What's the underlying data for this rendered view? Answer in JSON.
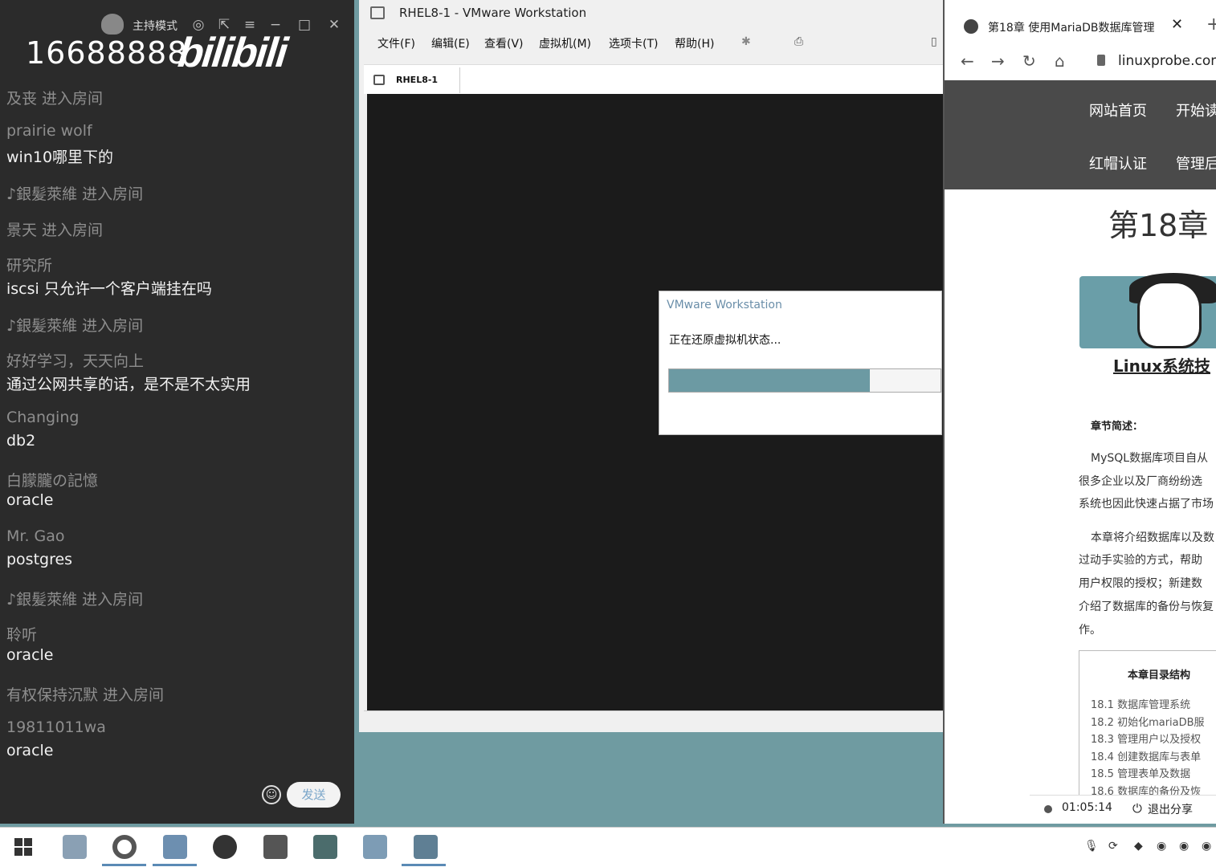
{
  "chat": {
    "room_id": "16688888",
    "logo": "bilibili",
    "host_mode_label": "主持模式",
    "messages": [
      {
        "kind": "enter",
        "text": "及丧 进入房间"
      },
      {
        "kind": "user",
        "text": "prairie wolf"
      },
      {
        "kind": "text",
        "text": "win10哪里下的"
      },
      {
        "kind": "enter",
        "text": "♪銀髪萊維 进入房间"
      },
      {
        "kind": "enter",
        "text": "景天 进入房间"
      },
      {
        "kind": "user",
        "text": "研究所"
      },
      {
        "kind": "text",
        "text": "iscsi 只允许一个客户端挂在吗"
      },
      {
        "kind": "enter",
        "text": "♪銀髪萊維 进入房间"
      },
      {
        "kind": "user",
        "text": "好好学习，天天向上"
      },
      {
        "kind": "text",
        "text": "通过公网共享的话，是不是不太实用"
      },
      {
        "kind": "user",
        "text": "Changing"
      },
      {
        "kind": "text",
        "text": "db2"
      },
      {
        "kind": "user",
        "text": "白朦朧の記憶"
      },
      {
        "kind": "text",
        "text": "oracle"
      },
      {
        "kind": "user",
        "text": "Mr. Gao"
      },
      {
        "kind": "text",
        "text": "postgres"
      },
      {
        "kind": "enter",
        "text": "♪銀髪萊維 进入房间"
      },
      {
        "kind": "user",
        "text": "聆听"
      },
      {
        "kind": "text",
        "text": "oracle"
      },
      {
        "kind": "enter",
        "text": "有权保持沉默 进入房间"
      },
      {
        "kind": "user",
        "text": "19811011wa"
      },
      {
        "kind": "text",
        "text": "oracle"
      }
    ],
    "send_label": "发送"
  },
  "vmware": {
    "title": "RHEL8-1 - VMware Workstation",
    "menu": [
      "文件(F)",
      "编辑(E)",
      "查看(V)",
      "虚拟机(M)",
      "选项卡(T)",
      "帮助(H)"
    ],
    "tab_label": "RHEL8-1",
    "dialog": {
      "title": "VMware Workstation",
      "message": "正在还原虚拟机状态...",
      "progress": 0.74
    }
  },
  "browser": {
    "tab_title": "第18章 使用MariaDB数据库管理",
    "url": "linuxprobe.com",
    "site_nav": [
      "网站首页",
      "开始读",
      "红帽认证",
      "管理后"
    ],
    "chapter_heading": "第18章",
    "book_title": "Linux系统技",
    "summary_label": "章节简述：",
    "paragraph_lines": [
      "MySQL数据库项目自从",
      "很多企业以及厂商纷纷选",
      "系统也因此快速占据了市场",
      "本章将介绍数据库以及数",
      "过动手实验的方式，帮助",
      "用户权限的授权；新建数",
      "介绍了数据库的备份与恢复",
      "作。"
    ],
    "toc_title": "本章目录结构",
    "toc": [
      "18.1 数据库管理系统",
      "18.2 初始化mariaDB服",
      "18.3 管理用户以及授权",
      "18.4 创建数据库与表单",
      "18.5 管理表单及数据",
      "18.6 数据库的备份及恢"
    ],
    "share_time": "01:05:14",
    "exit_share_label": "退出分享"
  },
  "colors": {
    "chat_bg": "#2b2b2b",
    "desktop_teal": "#6f9ba1",
    "vm_screen": "#1b1b1b",
    "progress_fill": "#6c9aa3",
    "site_nav_bg": "#4a4a4a"
  }
}
